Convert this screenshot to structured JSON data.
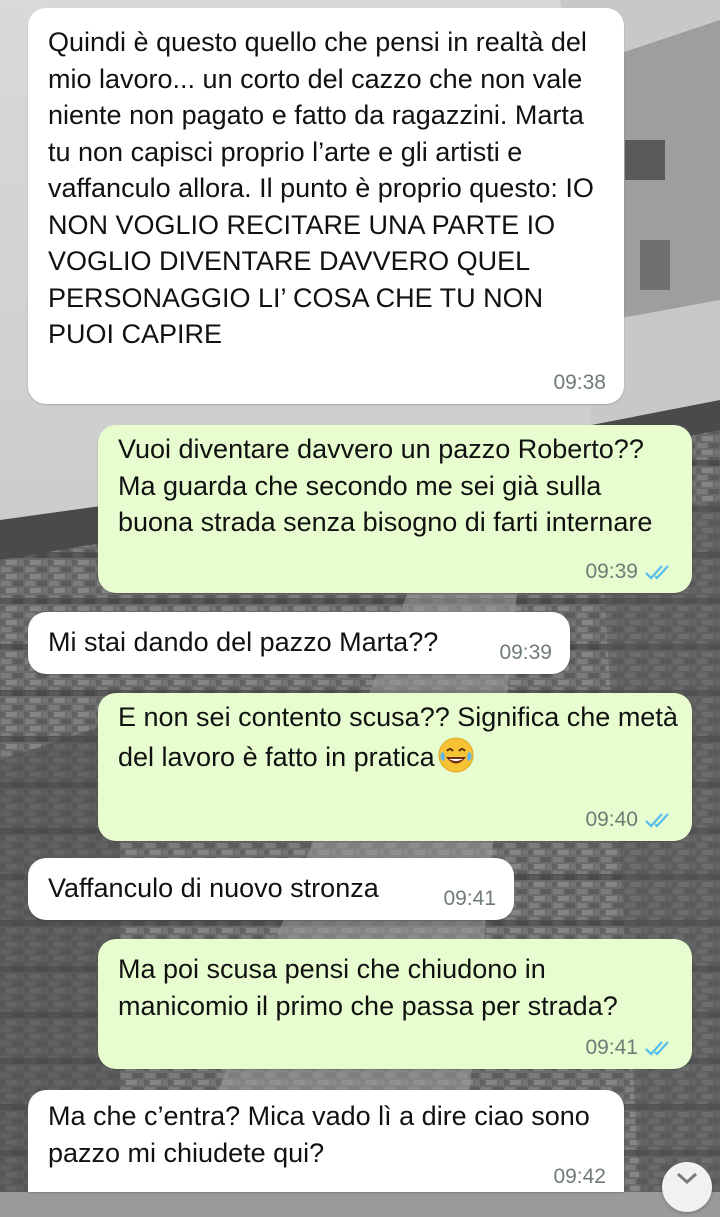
{
  "messages": [
    {
      "direction": "in",
      "text": "Quindi è questo quello che pensi in realtà del mio lavoro... un  corto del cazzo che non vale niente non pagato e fatto da ragazzini. Marta tu non capisci proprio l’arte e gli artisti e vaffanculo allora. Il punto è proprio questo: IO NON VOGLIO RECITARE UNA PARTE IO VOGLIO DIVENTARE DAVVERO QUEL PERSONAGGIO LI’ COSA CHE TU NON PUOI CAPIRE",
      "time": "09:38"
    },
    {
      "direction": "out",
      "text": "Vuoi diventare davvero un pazzo Roberto?? Ma guarda che secondo me sei già sulla buona strada senza bisogno di farti internare",
      "time": "09:39",
      "status": "read"
    },
    {
      "direction": "in",
      "text": "Mi stai dando del pazzo Marta??",
      "time": "09:39"
    },
    {
      "direction": "out",
      "text": "E non sei contento scusa?? Significa che metà del lavoro è fatto in pratica",
      "emoji": "face-with-tears-of-joy",
      "time": "09:40",
      "status": "read"
    },
    {
      "direction": "in",
      "text": "Vaffanculo di nuovo stronza",
      "time": "09:41"
    },
    {
      "direction": "out",
      "text": "Ma poi scusa pensi che chiudono in manicomio il primo che passa per strada?",
      "time": "09:41",
      "status": "read"
    },
    {
      "direction": "in",
      "text": "Ma che c’entra? Mica vado lì a dire ciao sono pazzo mi chiudete qui?",
      "time": "09:42"
    }
  ],
  "colors": {
    "incoming": "#ffffff",
    "outgoing": "#e7fccf",
    "read_ticks": "#53bdeb",
    "time": "#6f7b75"
  },
  "icons": {
    "read_receipt": "double-check-icon",
    "scroll_down": "chevron-down-icon"
  }
}
